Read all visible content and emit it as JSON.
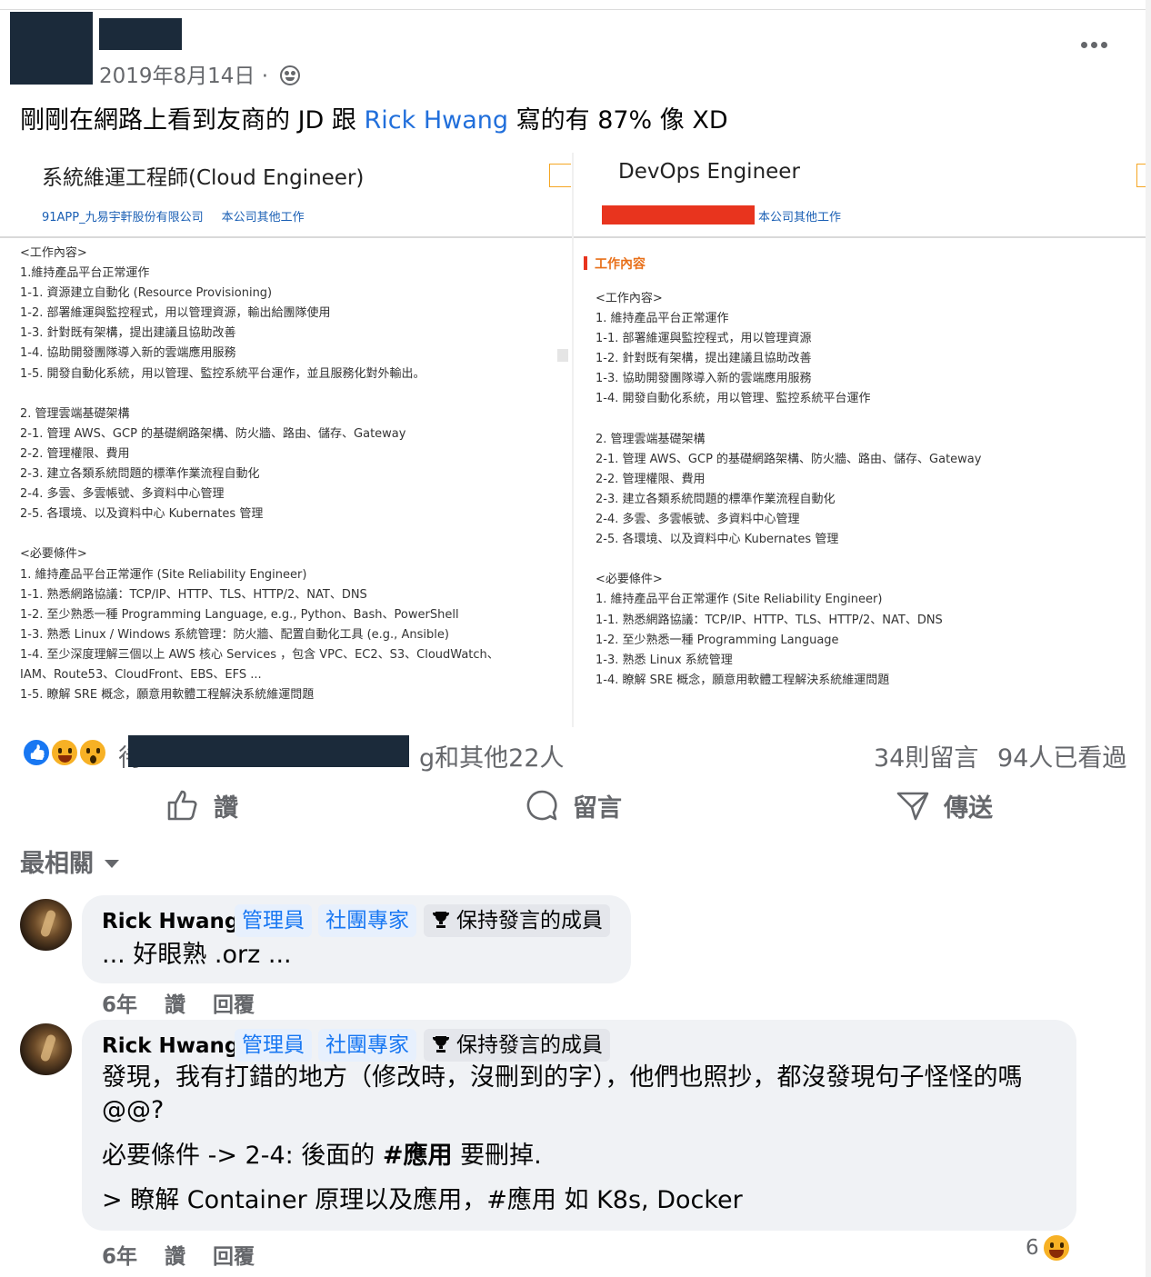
{
  "post": {
    "date": "2019年8月14日 · ",
    "privacy_icon": "group-icon",
    "text_before": "剛剛在網路上看到友商的 JD 跟 ",
    "mention": "Rick Hwang",
    "text_after": " 寫的有 87% 像 XD"
  },
  "left_jd": {
    "title": "系統維運工程師(Cloud Engineer)",
    "company": "91APP_九易宇軒股份有限公司",
    "other_jobs": "本公司其他工作",
    "lines": [
      "<工作內容>",
      "1.維持產品平台正常運作",
      "1-1. 資源建立自動化 (Resource Provisioning)",
      "1-2. 部署維運與監控程式，用以管理資源，輸出給團隊使用",
      "1-3. 針對既有架構，提出建議且協助改善",
      "1-4. 協助開發團隊導入新的雲端應用服務",
      "1-5. 開發自動化系統，用以管理、監控系統平台運作，並且服務化對外輸出。",
      "",
      "2. 管理雲端基礎架構",
      "2-1. 管理 AWS、GCP 的基礎網路架構、防火牆、路由、儲存、Gateway",
      "2-2. 管理權限、費用",
      "2-3. 建立各類系統問題的標準作業流程自動化",
      "2-4. 多雲、多雲帳號、多資料中心管理",
      "2-5. 各環境、以及資料中心 Kubernates 管理",
      "",
      "<必要條件>",
      "1. 維持產品平台正常運作 (Site Reliability Engineer)",
      "1-1. 熟悉網路協議：TCP/IP、HTTP、TLS、HTTP/2、NAT、DNS",
      "1-2. 至少熟悉一種 Programming Language, e.g., Python、Bash、PowerShell",
      "1-3. 熟悉 Linux / Windows 系統管理：防火牆、配置自動化工具 (e.g., Ansible)",
      "1-4. 至少深度理解三個以上 AWS 核心 Services ，包含 VPC、EC2、S3、CloudWatch、",
      "IAM、Route53、CloudFront、EBS、EFS ...",
      "1-5. 瞭解 SRE 概念，願意用軟體工程解決系統維運問題"
    ]
  },
  "right_jd": {
    "title": "DevOps Engineer",
    "other_jobs": "本公司其他工作",
    "section_heading": "工作內容",
    "lines": [
      "<工作內容>",
      "1. 維持產品平台正常運作",
      "1-1. 部署維運與監控程式，用以管理資源",
      "1-2. 針對既有架構，提出建議且協助改善",
      "1-3. 協助開發團隊導入新的雲端應用服務",
      "1-4. 開發自動化系統，用以管理、監控系統平台運作",
      "",
      "2. 管理雲端基礎架構",
      "2-1. 管理 AWS、GCP 的基礎網路架構、防火牆、路由、儲存、Gateway",
      "2-2. 管理權限、費用",
      "2-3. 建立各類系統問題的標準作業流程自動化",
      "2-4. 多雲、多雲帳號、多資料中心管理",
      "2-5. 各環境、以及資料中心 Kubernates 管理",
      "",
      "<必要條件>",
      "1. 維持產品平台正常運作 (Site Reliability Engineer)",
      "1-1. 熟悉網路協議：TCP/IP、HTTP、TLS、HTTP/2、NAT、DNS",
      "1-2. 至少熟悉一種 Programming Language",
      "1-3. 熟悉 Linux 系統管理",
      "1-4. 瞭解 SRE 概念，願意用軟體工程解決系統維運問題"
    ]
  },
  "stats": {
    "reactions_icons": [
      "like-icon",
      "haha-icon",
      "wow-icon"
    ],
    "reactors_prefix": "待",
    "reactors_suffix": "g和其他22人",
    "comments": "34則留言",
    "views": "94人已看過"
  },
  "actions": {
    "like": "讚",
    "comment": "留言",
    "share": "傳送"
  },
  "sort": {
    "label": "最相關"
  },
  "comments": [
    {
      "author": "Rick Hwang",
      "badges": [
        "管理員",
        "社團專家",
        "保持發言的成員"
      ],
      "text": [
        ". 好眼熟 .orz ..."
      ],
      "text_prefix": "..",
      "time": "6年",
      "like": "讚",
      "reply": "回覆"
    },
    {
      "author": "Rick Hwang",
      "badges": [
        "管理員",
        "社團專家",
        "保持發言的成員"
      ],
      "text": [
        "發現，我有打錯的地方（修改時，沒刪到的字），他們也照抄，都沒發現句子怪怪的嗎",
        "@@?",
        "必要條件 -> 2-4: 後面的 ",
        "> 瞭解 Container 原理以及應用，#應用 如 K8s, Docker"
      ],
      "bold_tag": "#應用",
      "after_bold": " 要刪掉.",
      "time": "6年",
      "like": "讚",
      "reply": "回覆",
      "reaction_count": "6"
    }
  ]
}
